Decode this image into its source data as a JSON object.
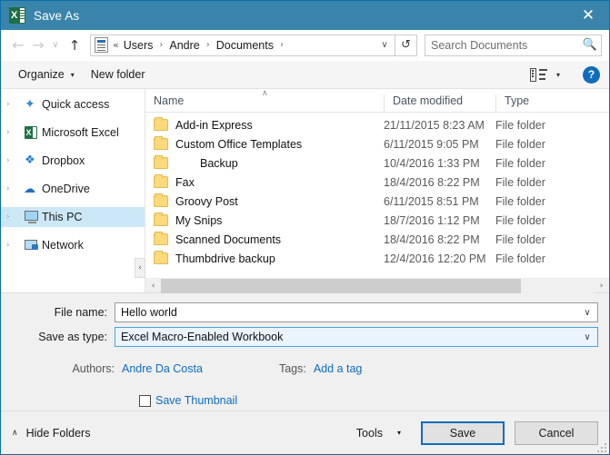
{
  "window": {
    "title": "Save As",
    "app_icon": "excel-icon",
    "close_label": "✕",
    "titlebar_color": "#3a84ab",
    "accent_color": "#0f6cbd"
  },
  "address_bar": {
    "back_label": "←",
    "forward_label": "→",
    "recent_label": "∨",
    "up_label": "↑",
    "location_icon": "documents-folder-icon",
    "prefix": "«",
    "crumbs": [
      "Users",
      "Andre",
      "Documents"
    ],
    "separator": "›",
    "dropdown_label": "∨",
    "refresh_label": "↺"
  },
  "search": {
    "placeholder": "Search Documents",
    "value": "",
    "icon": "search-icon"
  },
  "toolbar": {
    "organize_label": "Organize",
    "organize_caret": "▾",
    "new_folder_label": "New folder",
    "view_icon": "view-options-icon",
    "view_caret": "▾",
    "help_label": "?"
  },
  "sidebar": {
    "items": [
      {
        "label": "Quick access",
        "icon": "quick-access-star-icon",
        "icon_class": "ico-star",
        "glyph": "✦",
        "selected": false,
        "expander": "›"
      },
      {
        "label": "Microsoft Excel",
        "icon": "microsoft-excel-icon",
        "icon_class": "ico-excel",
        "glyph": "X",
        "selected": false,
        "expander": "›"
      },
      {
        "label": "Dropbox",
        "icon": "dropbox-icon",
        "icon_class": "ico-drop",
        "glyph": "❖",
        "selected": false,
        "expander": "›"
      },
      {
        "label": "OneDrive",
        "icon": "onedrive-cloud-icon",
        "icon_class": "ico-cloud",
        "glyph": "☁",
        "selected": false,
        "expander": "›"
      },
      {
        "label": "This PC",
        "icon": "this-pc-monitor-icon",
        "icon_class": "ico-pc",
        "glyph": "",
        "selected": true,
        "expander": "›"
      },
      {
        "label": "Network",
        "icon": "network-icon",
        "icon_class": "ico-net",
        "glyph": "",
        "selected": false,
        "expander": "›"
      }
    ],
    "splitter_label": "‹"
  },
  "file_list": {
    "sort_caret": "∧",
    "columns": [
      "Name",
      "Date modified",
      "Type"
    ],
    "rows": [
      {
        "name": "Add-in Express",
        "date": "21/11/2015 8:23 AM",
        "type": "File folder",
        "indent": false
      },
      {
        "name": "Custom Office Templates",
        "date": "6/11/2015 9:05 PM",
        "type": "File folder",
        "indent": false
      },
      {
        "name": "Backup",
        "date": "10/4/2016 1:33 PM",
        "type": "File folder",
        "indent": true
      },
      {
        "name": "Fax",
        "date": "18/4/2016 8:22 PM",
        "type": "File folder",
        "indent": false
      },
      {
        "name": "Groovy Post",
        "date": "6/11/2015 8:51 PM",
        "type": "File folder",
        "indent": false
      },
      {
        "name": "My Snips",
        "date": "18/7/2016 1:12 PM",
        "type": "File folder",
        "indent": false
      },
      {
        "name": "Scanned Documents",
        "date": "18/4/2016 8:22 PM",
        "type": "File folder",
        "indent": false
      },
      {
        "name": "Thumbdrive backup",
        "date": "12/4/2016 12:20 PM",
        "type": "File folder",
        "indent": false
      }
    ],
    "hscroll_left": "‹",
    "hscroll_right": "›"
  },
  "form": {
    "file_name_label": "File name:",
    "file_name_value": "Hello world",
    "save_as_type_label": "Save as type:",
    "save_as_type_value": "Excel Macro-Enabled Workbook",
    "combo_caret": "∨",
    "authors_label": "Authors:",
    "authors_value": "Andre Da Costa",
    "tags_label": "Tags:",
    "tags_value": "Add a tag",
    "save_thumbnail_label": "Save Thumbnail",
    "save_thumbnail_checked": false
  },
  "footer": {
    "hide_folders_label": "Hide Folders",
    "hide_folders_caret": "∧",
    "tools_label": "Tools",
    "tools_caret": "▾",
    "save_label": "Save",
    "cancel_label": "Cancel"
  }
}
